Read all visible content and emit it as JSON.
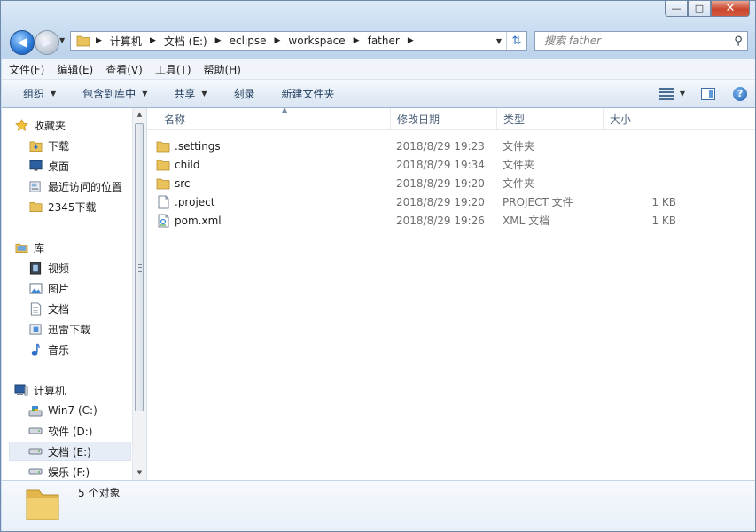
{
  "window": {
    "caption_buttons": [
      "—",
      "□",
      "✕"
    ]
  },
  "address": {
    "crumbs": [
      "计算机",
      "文档 (E:)",
      "eclipse",
      "workspace",
      "father"
    ]
  },
  "search": {
    "placeholder": "搜索 father"
  },
  "menu": [
    "文件(F)",
    "编辑(E)",
    "查看(V)",
    "工具(T)",
    "帮助(H)"
  ],
  "toolbar": {
    "organize": "组织",
    "include_library": "包含到库中",
    "share": "共享",
    "burn": "刻录",
    "new_folder": "新建文件夹"
  },
  "nav": {
    "favorites": {
      "label": "收藏夹",
      "items": [
        "下载",
        "桌面",
        "最近访问的位置",
        "2345下载"
      ]
    },
    "libraries": {
      "label": "库",
      "items": [
        "视频",
        "图片",
        "文档",
        "迅雷下载",
        "音乐"
      ]
    },
    "computer": {
      "label": "计算机",
      "items": [
        "Win7 (C:)",
        "软件 (D:)",
        "文档 (E:)",
        "娱乐 (F:)"
      ],
      "selected": "文档 (E:)"
    }
  },
  "columns": [
    "名称",
    "修改日期",
    "类型",
    "大小"
  ],
  "files": [
    {
      "name": ".settings",
      "date": "2018/8/29 19:23",
      "type": "文件夹",
      "size": "",
      "icon": "folder-icon"
    },
    {
      "name": "child",
      "date": "2018/8/29 19:34",
      "type": "文件夹",
      "size": "",
      "icon": "folder-icon"
    },
    {
      "name": "src",
      "date": "2018/8/29 19:20",
      "type": "文件夹",
      "size": "",
      "icon": "folder-icon"
    },
    {
      "name": ".project",
      "date": "2018/8/29 19:20",
      "type": "PROJECT 文件",
      "size": "1 KB",
      "icon": "file-icon"
    },
    {
      "name": "pom.xml",
      "date": "2018/8/29 19:26",
      "type": "XML 文档",
      "size": "1 KB",
      "icon": "xml-file-icon"
    }
  ],
  "status": {
    "count": "5 个对象"
  },
  "colors": {
    "folder": "#e9c25b",
    "frame": "#c9dcf0",
    "toolbar_text": "#1e3b5c",
    "accent": "#2b78d6"
  }
}
